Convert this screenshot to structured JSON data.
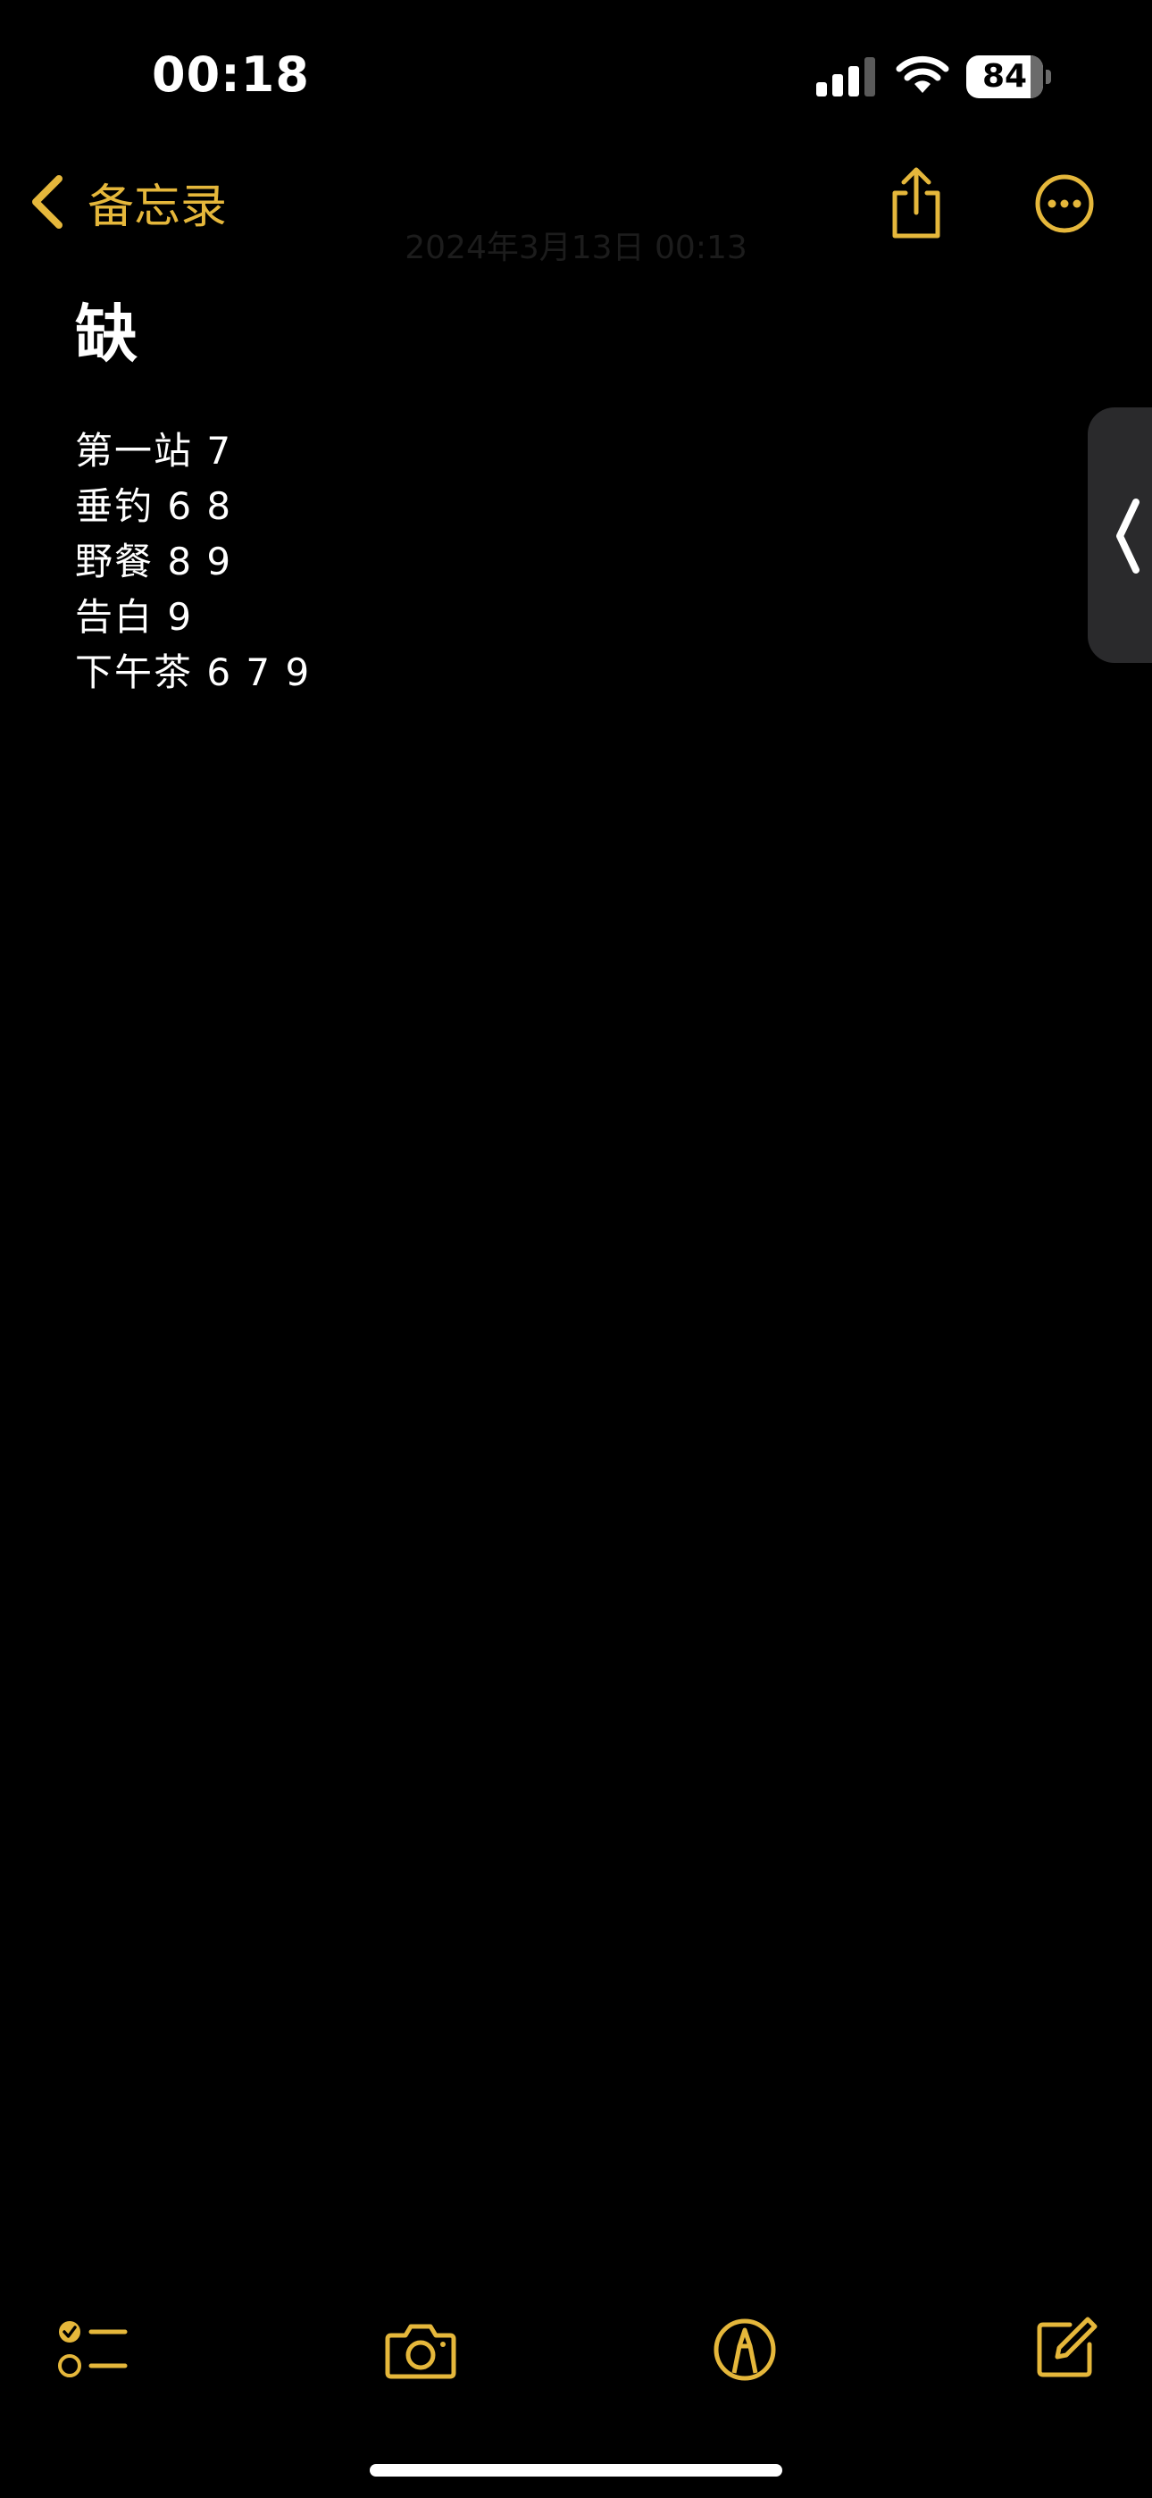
{
  "status_bar": {
    "time": "00:18",
    "battery_percent": "84",
    "battery_level": 0.84,
    "signal_icon": "cellular-signal-icon",
    "wifi_icon": "wifi-icon"
  },
  "nav": {
    "back_label": "备忘录",
    "back_icon": "chevron-left-icon",
    "share_icon": "share-icon",
    "more_icon": "ellipsis-circle-icon",
    "date": "2024年3月13日 00:13"
  },
  "note": {
    "title": "缺",
    "lines": [
      "第一站 7",
      "垂钓 6 8",
      "野餐 8 9",
      "告白 9",
      "下午茶 6 7 9"
    ]
  },
  "side_handle": {
    "icon": "chevron-left-icon"
  },
  "toolbar": {
    "checklist_icon": "checklist-icon",
    "camera_icon": "camera-icon",
    "markup_icon": "markup-pen-icon",
    "compose_icon": "compose-icon"
  },
  "colors": {
    "accent": "#e5b73b",
    "background": "#000000",
    "text": "#ffffff",
    "side_handle": "#2a2a2c"
  }
}
